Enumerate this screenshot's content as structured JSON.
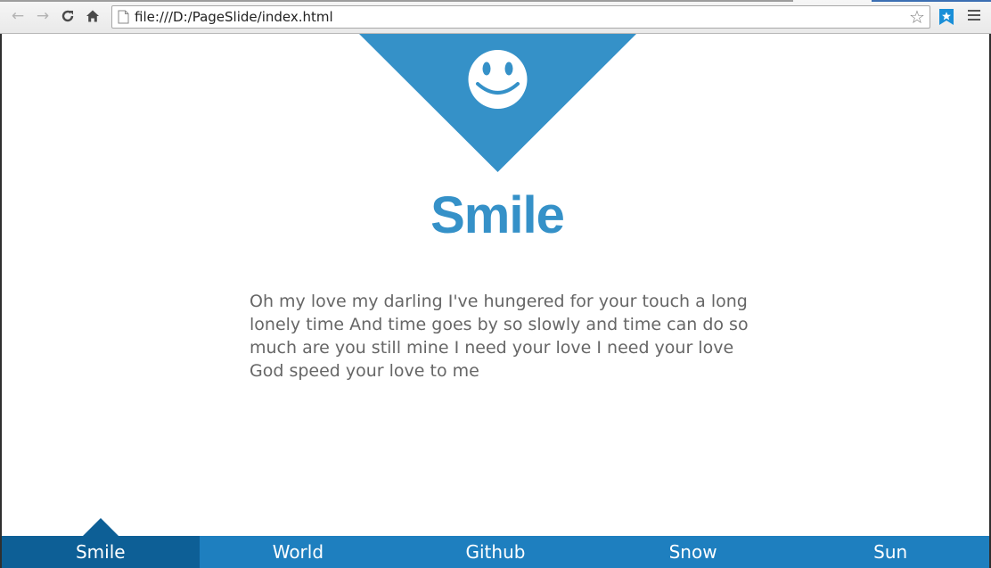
{
  "browser": {
    "url": "file:///D:/PageSlide/index.html",
    "icons": {
      "back": "back-arrow-icon",
      "forward": "forward-arrow-icon",
      "reload": "reload-icon",
      "home": "home-icon",
      "page": "page-icon",
      "bookmark": "star-icon",
      "extension": "bookmark-extension-icon",
      "menu": "menu-icon"
    }
  },
  "slide": {
    "icon": "smiley-face-icon",
    "accent_color": "#3591c8",
    "title": "Smile",
    "text": "Oh my love my darling I've hungered for your touch a long lonely time And time goes by so slowly and time can do so much are you still mine I need your love I need your love God speed your love to me"
  },
  "nav": {
    "background_color": "#1e7fbf",
    "active_color": "#0d5f96",
    "active_index": 0,
    "items": [
      {
        "label": "Smile"
      },
      {
        "label": "World"
      },
      {
        "label": "Github"
      },
      {
        "label": "Snow"
      },
      {
        "label": "Sun"
      }
    ]
  }
}
